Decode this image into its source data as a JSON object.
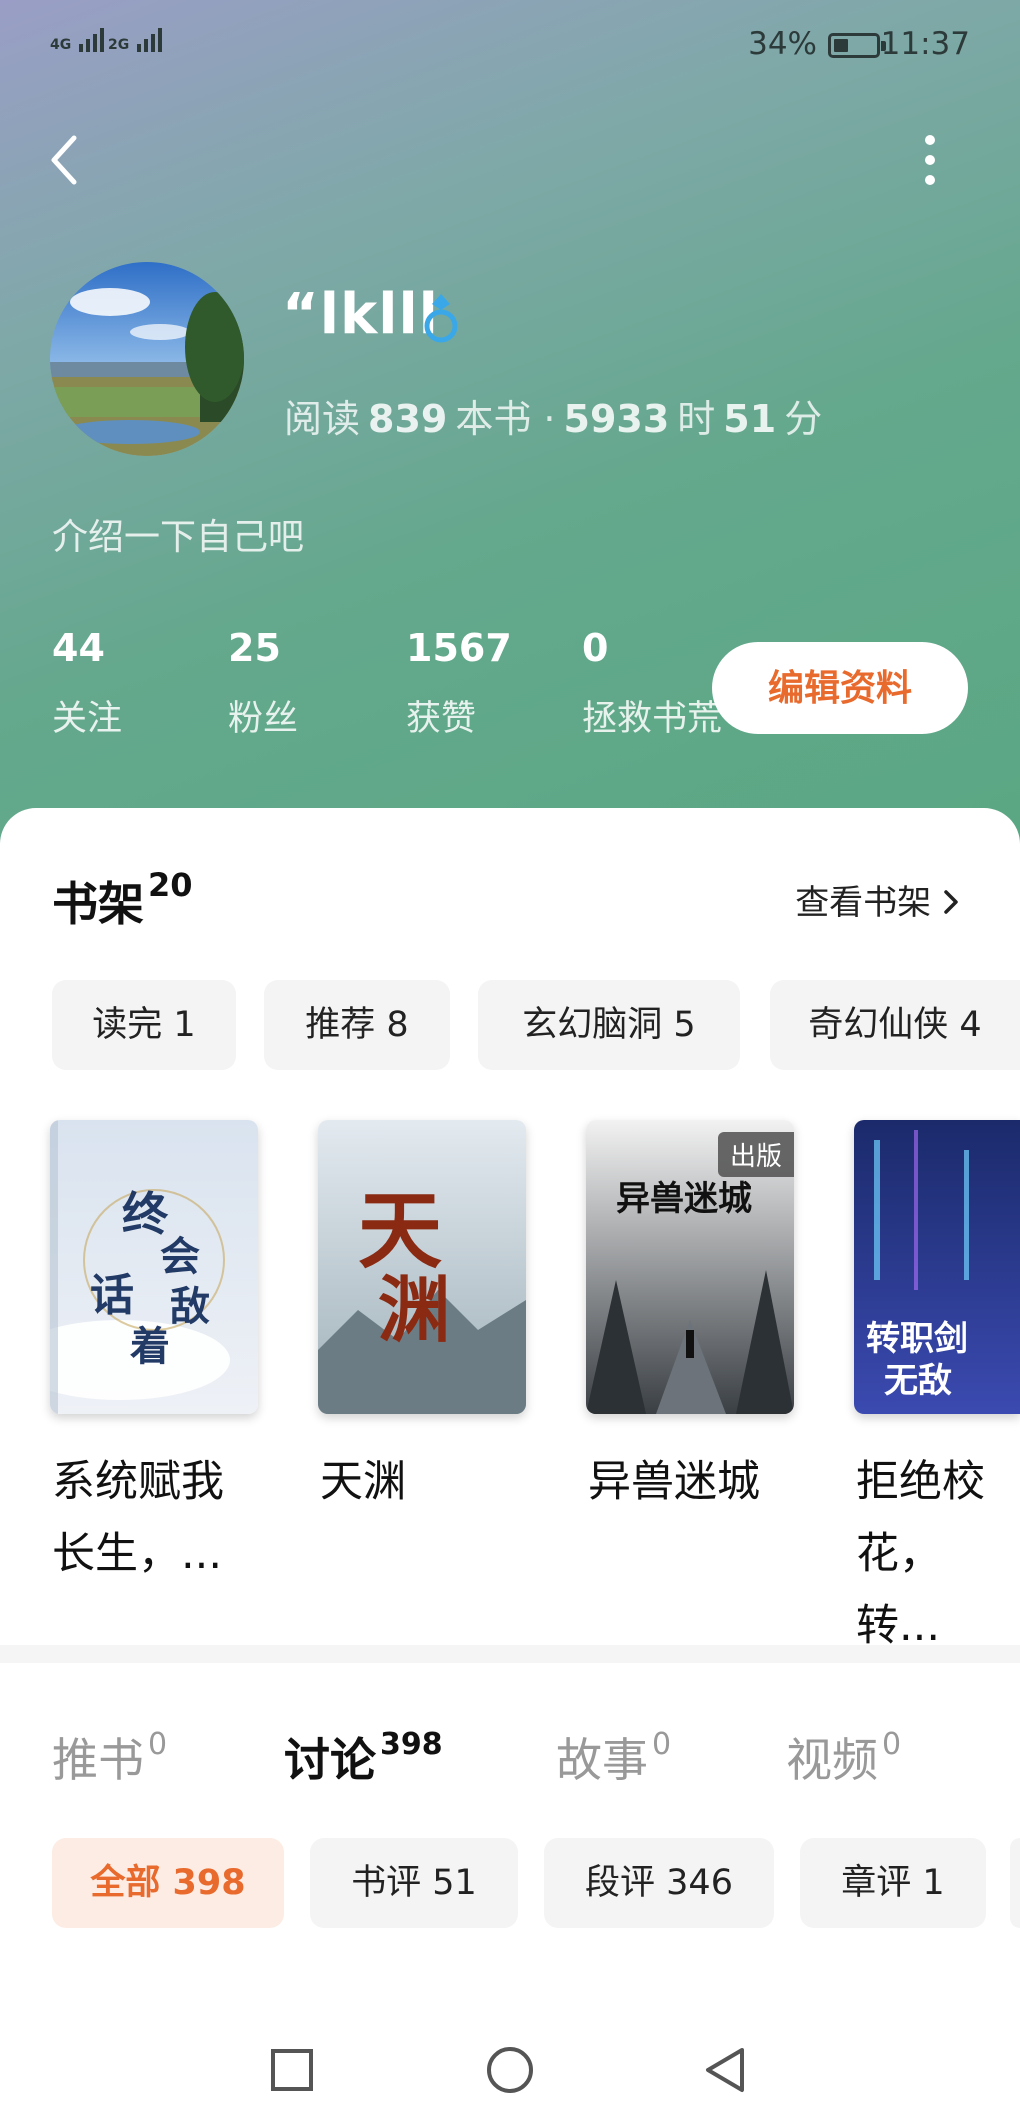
{
  "status_bar": {
    "signal1_label": "4G",
    "signal2_label": "2G",
    "battery_percent_text": "34%",
    "battery_level": 0.34,
    "time": "11:37"
  },
  "profile": {
    "name": "“lklll",
    "reading_label": "阅读",
    "books_count": "839",
    "books_unit": "本书 ·",
    "hours": "5933",
    "hours_unit": "时",
    "minutes": "51",
    "minutes_unit": "分",
    "intro": "介绍一下自己吧",
    "gender_icon": "male-ring-icon"
  },
  "stats": [
    {
      "num": "44",
      "label": "关注"
    },
    {
      "num": "25",
      "label": "粉丝"
    },
    {
      "num": "1567",
      "label": "获赞"
    },
    {
      "num": "0",
      "label": "拯救书荒"
    }
  ],
  "edit_button": "编辑资料",
  "shelf": {
    "title": "书架",
    "count": "20",
    "view_all": "查看书架",
    "chips": [
      "读完 1",
      "推荐 8",
      "玄幻脑洞 5",
      "奇幻仙侠 4"
    ],
    "books": [
      {
        "title": "系统赋我长生，...",
        "cover_text": "终会无敌话着"
      },
      {
        "title": "天渊",
        "cover_text": "天渊"
      },
      {
        "title": "异兽迷城",
        "cover_text": "异兽迷城",
        "badge": "出版"
      },
      {
        "title": "拒绝校花，转...",
        "cover_text": "转职剑仙无敌了"
      }
    ]
  },
  "tabs": [
    {
      "label": "推书",
      "count": "0"
    },
    {
      "label": "讨论",
      "count": "398"
    },
    {
      "label": "故事",
      "count": "0"
    },
    {
      "label": "视频",
      "count": "0"
    }
  ],
  "filters": [
    "全部 398",
    "书评 51",
    "段评 346",
    "章评 1"
  ],
  "colors": {
    "accent": "#e86a2d",
    "hero_top": "#9a9ec6",
    "hero_bottom": "#5aa783"
  }
}
